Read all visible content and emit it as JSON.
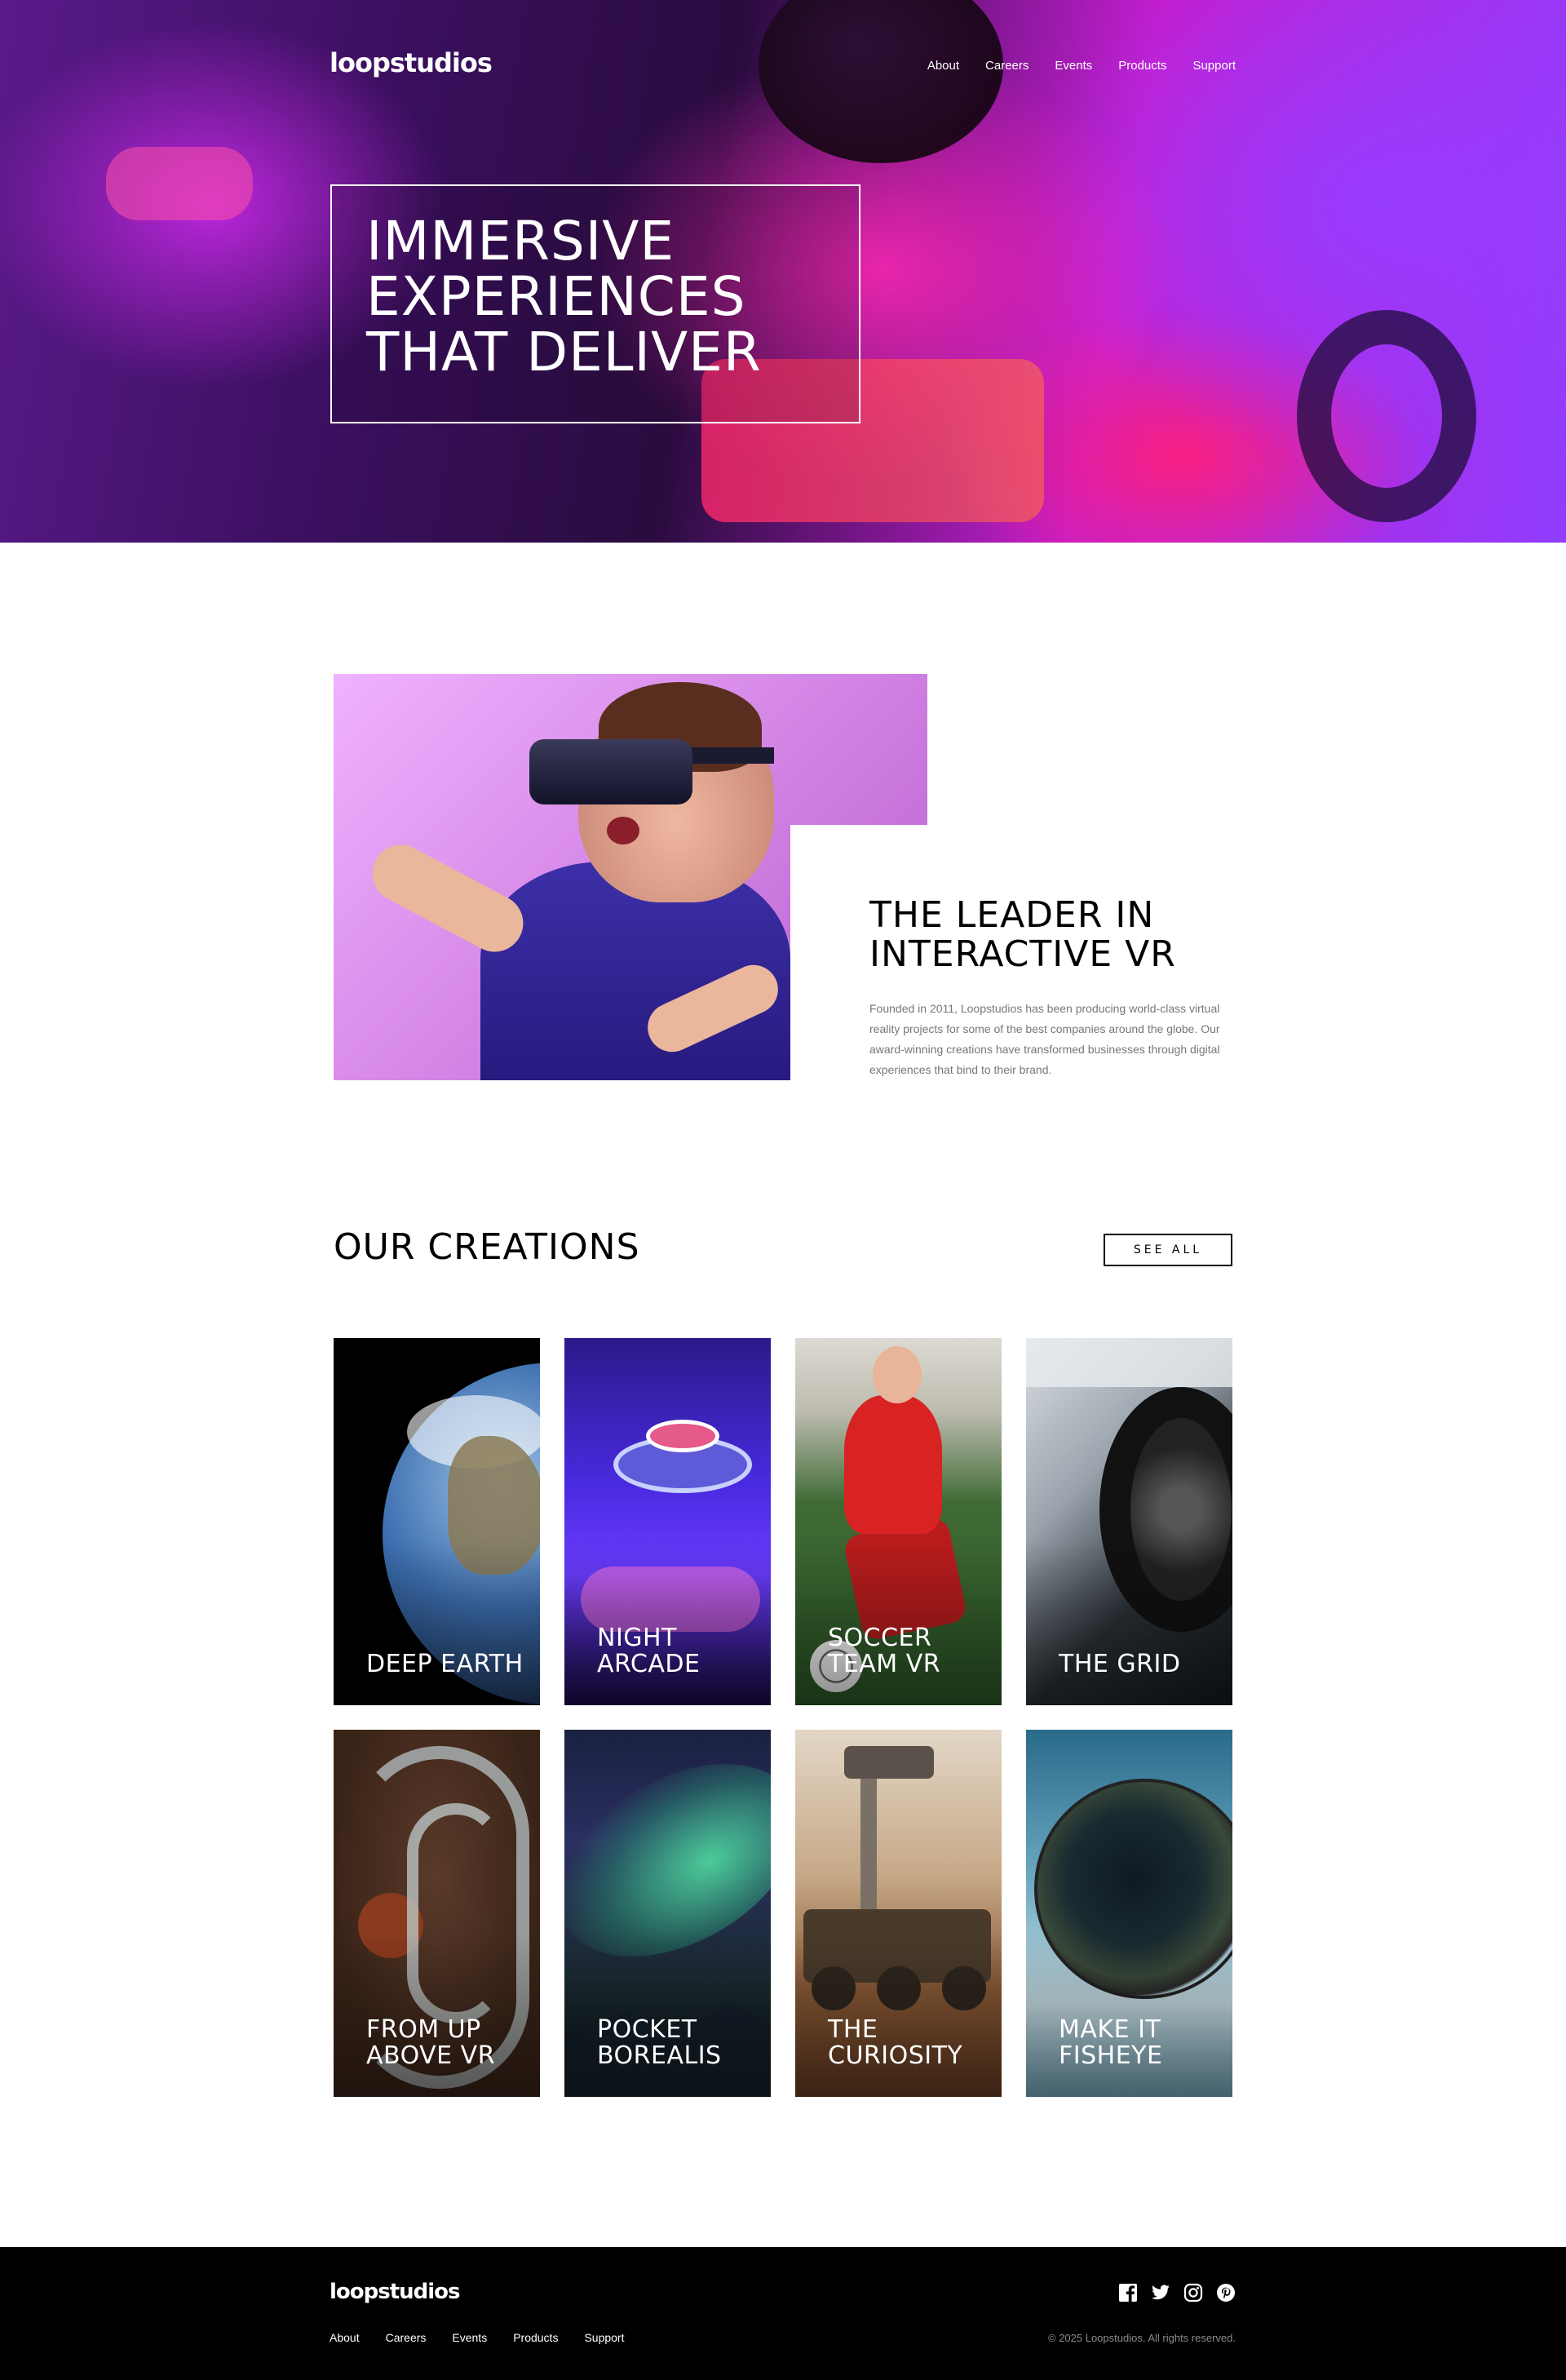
{
  "brand": {
    "name": "loopstudios"
  },
  "nav": [
    "About",
    "Careers",
    "Events",
    "Products",
    "Support"
  ],
  "hero": {
    "headline": "Immersive experiences that deliver"
  },
  "intro": {
    "heading": "The leader in interactive VR",
    "body": "Founded in 2011, Loopstudios has been producing world-class virtual reality projects for some of the best companies around the globe. Our award-winning creations have transformed businesses through digital experiences that bind to their brand."
  },
  "creations": {
    "title": "Our creations",
    "see_all": "See all",
    "items": [
      {
        "label": "Deep Earth"
      },
      {
        "label": "Night Arcade"
      },
      {
        "label": "Soccer Team VR"
      },
      {
        "label": "The Grid"
      },
      {
        "label": "From up above VR"
      },
      {
        "label": "Pocket Borealis"
      },
      {
        "label": "The Curiosity"
      },
      {
        "label": "Make it fisheye"
      }
    ]
  },
  "footer": {
    "logo": "loopstudios",
    "nav": [
      "About",
      "Careers",
      "Events",
      "Products",
      "Support"
    ],
    "socials": [
      "facebook-icon",
      "twitter-icon",
      "instagram-icon",
      "pinterest-icon"
    ],
    "copyright": "© 2025 Loopstudios. All rights reserved."
  }
}
